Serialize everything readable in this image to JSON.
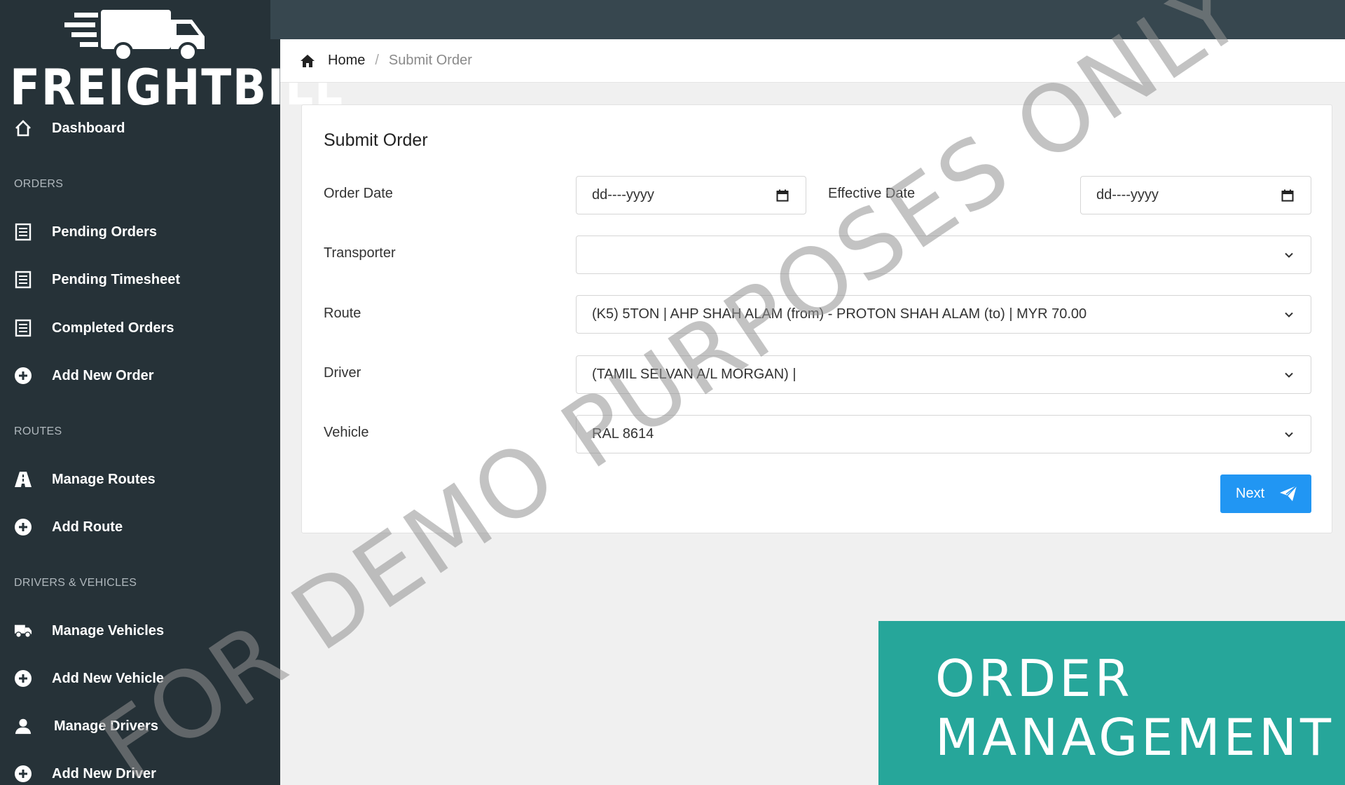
{
  "brand": {
    "name": "FREIGHTBILL"
  },
  "sidebar": {
    "dashboard": "Dashboard",
    "sections": {
      "orders": "ORDERS",
      "routes": "ROUTES",
      "drivers_vehicles": "DRIVERS & VEHICLES"
    },
    "items": {
      "pending_orders": "Pending Orders",
      "pending_timesheet": "Pending Timesheet",
      "completed_orders": "Completed Orders",
      "add_new_order": "Add New Order",
      "manage_routes": "Manage Routes",
      "add_route": "Add Route",
      "manage_vehicles": "Manage Vehicles",
      "add_new_vehicle": "Add New Vehicle",
      "manage_drivers": "Manage Drivers",
      "add_new_driver": "Add New Driver"
    }
  },
  "breadcrumb": {
    "home": "Home",
    "separator": "/",
    "current": "Submit Order"
  },
  "form": {
    "title": "Submit Order",
    "order_date": {
      "label": "Order Date",
      "value": "dd----yyyy"
    },
    "effective_date": {
      "label": "Effective Date",
      "value": "dd----yyyy"
    },
    "transporter": {
      "label": "Transporter",
      "value": ""
    },
    "route": {
      "label": "Route",
      "value": "(K5) 5TON | AHP SHAH ALAM (from) - PROTON SHAH ALAM (to) | MYR 70.00"
    },
    "driver": {
      "label": "Driver",
      "value": "(TAMIL SELVAN A/L MORGAN) |"
    },
    "vehicle": {
      "label": "Vehicle",
      "value": "RAL 8614"
    },
    "next_label": "Next"
  },
  "watermark": "FOR DEMO PURPOSES ONLY",
  "banner": {
    "line1": "ORDER",
    "line2": "MANAGEMENT"
  },
  "colors": {
    "sidebar_bg": "#263238",
    "topbar_bg": "#37474f",
    "primary": "#2196f3",
    "banner_bg": "#26a69a"
  }
}
